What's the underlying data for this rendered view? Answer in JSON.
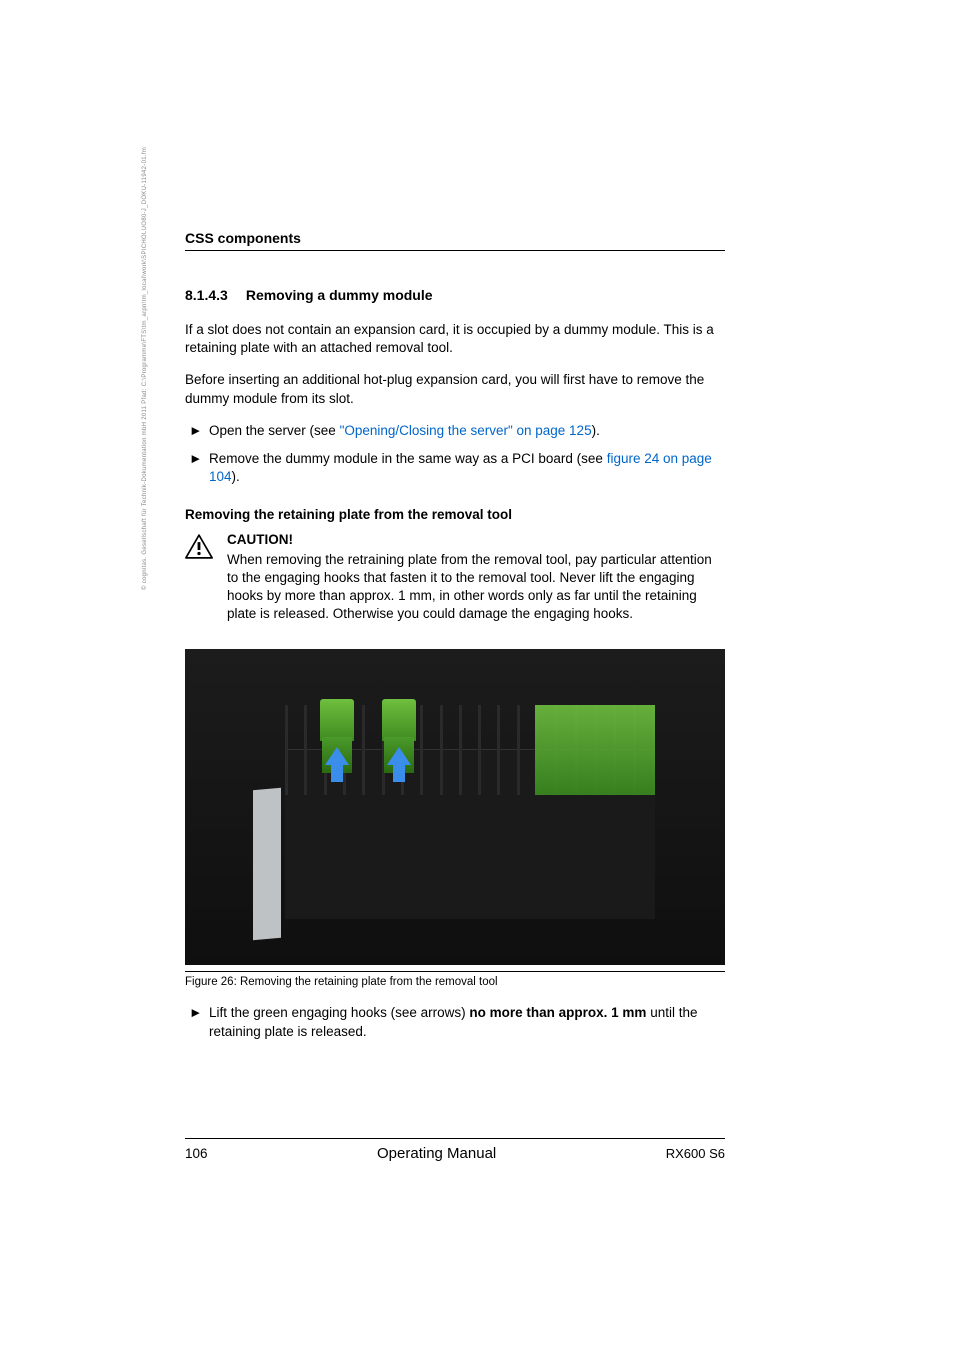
{
  "header": {
    "title": "CSS components"
  },
  "side_text": "© cognitas. Gesellschaft für Technik-Dokumentation mbH 2011     Pfad: C:\\Programme\\FTS\\tm_arpn\\tm_local\\work\\SPICHOLUO80-J_DOKU-11942-01.fm",
  "section": {
    "number": "8.1.4.3",
    "title": "Removing a dummy module"
  },
  "paragraphs": {
    "p1": "If a slot does not contain an expansion card, it is occupied by a dummy module. This is a retaining plate with an attached removal tool.",
    "p2": "Before inserting an additional hot-plug expansion card, you will first have to remove the dummy module from its slot."
  },
  "bullets": {
    "b1_prefix": "Open the server (see ",
    "b1_link": "\"Opening/Closing the server\" on page 125",
    "b1_suffix": ").",
    "b2_prefix": "Remove the dummy module in the same way as a PCI board (see ",
    "b2_link": "figure 24 on page 104",
    "b2_suffix": ")."
  },
  "sub_heading": "Removing the retaining plate from the removal tool",
  "caution": {
    "title": "CAUTION!",
    "text": "When removing the retraining plate from the removal tool, pay particular attention to the engaging hooks that fasten it to the removal tool. Never lift the engaging hooks by more than approx. 1 mm, in other words only as far until the retaining plate is released. Otherwise you could damage the engaging hooks."
  },
  "figure": {
    "caption": "Figure 26: Removing the retaining plate from the removal tool"
  },
  "final_bullet": {
    "prefix": "Lift the green engaging hooks (see arrows) ",
    "bold": "no more than approx. 1 mm",
    "suffix": " until the retaining plate is released."
  },
  "footer": {
    "page": "106",
    "center": "Operating Manual",
    "right": "RX600 S6"
  }
}
